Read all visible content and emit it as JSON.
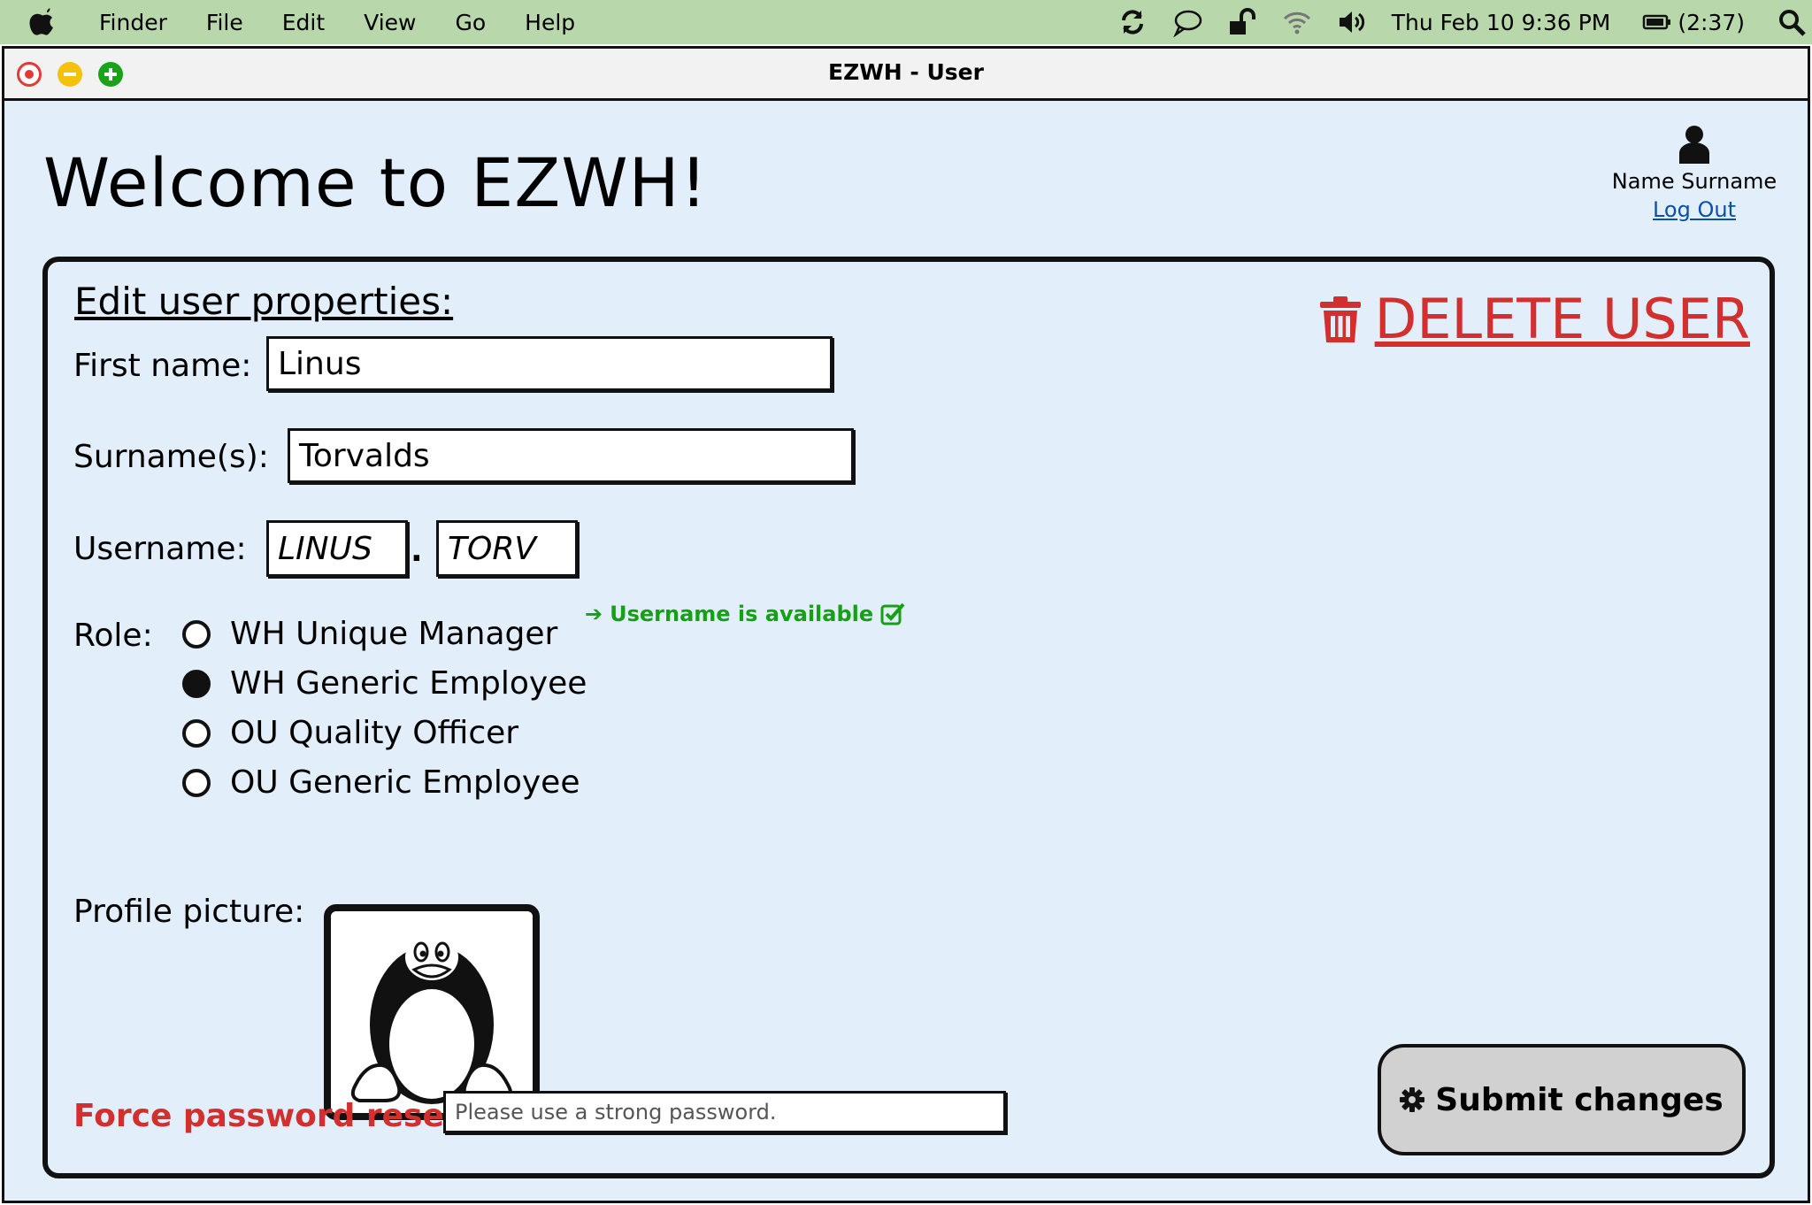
{
  "menubar": {
    "items": [
      "Finder",
      "File",
      "Edit",
      "View",
      "Go",
      "Help"
    ],
    "datetime": "Thu Feb 10  9:36 PM",
    "battery": "(2:37)",
    "icons": [
      "sync-icon",
      "chat-icon",
      "lock-icon",
      "wifi-icon",
      "volume-icon",
      "battery-icon",
      "search-icon"
    ]
  },
  "window": {
    "title": "EZWH - User"
  },
  "header": {
    "welcome": "Welcome to EZWH!",
    "user_name": "Name Surname",
    "logout": "Log Out"
  },
  "form": {
    "title": "Edit user properties:",
    "delete_label": "DELETE USER",
    "first_name_label": "First name:",
    "first_name_value": "Linus",
    "surname_label": "Surname(s):",
    "surname_value": "Torvalds",
    "username_label": "Username:",
    "username_part1": "LINUS",
    "username_sep": ".",
    "username_part2": "TORV",
    "username_status": "Username is available",
    "role_label": "Role:",
    "roles": [
      {
        "label": "WH Unique Manager",
        "checked": false
      },
      {
        "label": "WH Generic Employee",
        "checked": true
      },
      {
        "label": "OU Quality Officer",
        "checked": false
      },
      {
        "label": "OU Generic Employee",
        "checked": false
      }
    ],
    "picture_label": "Profile picture:",
    "force_reset_label": "Force password reset:",
    "password_placeholder": "Please use a strong password.",
    "submit_label": "Submit changes"
  },
  "colors": {
    "menubar": "#b8d8ac",
    "window_bg": "#e2effb",
    "danger": "#d32f2f",
    "success": "#16a016",
    "link": "#0a4fa8",
    "submit_bg": "#d1d1d1"
  }
}
